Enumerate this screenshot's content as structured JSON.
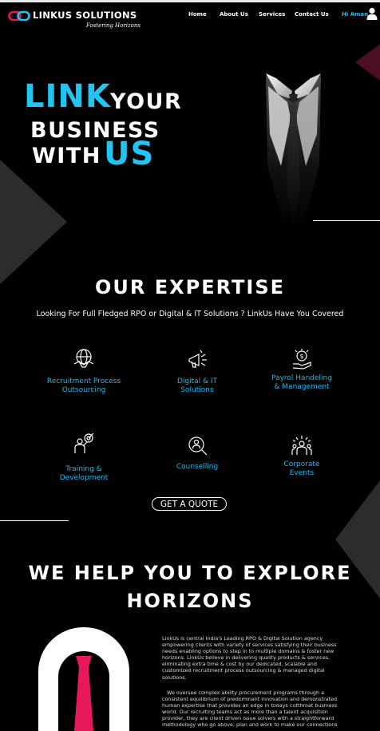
{
  "header": {
    "logo_name": "LINKUS SOLUTIONS",
    "logo_tagline": "Fostering Horizons",
    "nav": [
      "Home",
      "About Us",
      "Services",
      "Contact Us"
    ],
    "greeting": "Hi Aman"
  },
  "hero": {
    "link": "LINK",
    "your": "YOUR",
    "business": "BUSINESS",
    "with": "WITH",
    "us": "US"
  },
  "expertise": {
    "title": "OUR EXPERTISE",
    "subtitle": "Looking For Full Fledged RPO  or  Digital & IT Solutions ?  LinkUs Have You Covered",
    "services": [
      {
        "line1": "Recruitment Process",
        "line2": "Outsourcing",
        "icon": "handshake-globe-icon"
      },
      {
        "line1": "Digital & IT",
        "line2": "Solutions",
        "icon": "megaphone-icon"
      },
      {
        "line1": "Payrol Handeling",
        "line2": "& Management",
        "icon": "money-hand-icon"
      },
      {
        "line1": "Training &",
        "line2": "Development",
        "icon": "target-person-icon"
      },
      {
        "line1": "Counselling",
        "line2": "",
        "icon": "search-person-icon"
      },
      {
        "line1": "Corporate",
        "line2": "Events",
        "icon": "celebration-icon"
      }
    ],
    "cta": "GET A QUOTE"
  },
  "horizons": {
    "title_line1": "WE HELP YOU TO EXPLORE",
    "title_line2": "HORIZONS",
    "paragraph1": "LinkUs is central India's Leading RPO & Digital Solution agency empowering clients with variety of services satisfying their business needs enabling options to step in to multiple domains & foster new horizons. LinkUs believe in delivering quality products & services, eliminating extra time & cost by our dedicated, scalable and customized recruitment process outsourcing & managed digital solutions.",
    "paragraph2": "We oversee complex ability procurement programs through a consistent equilibrium of predominant innovation and demonstrated human expertise that provides an edge in todays cutthroat business world. Our recruiting teams act as more than a talent acquisition provider, they are client driven issue solvers with a straightforward methodology who go above, plan and work to make our connections"
  },
  "colors": {
    "accent_cyan": "#22c4f2",
    "tie_pink": "#e8195a",
    "background": "#000000"
  }
}
